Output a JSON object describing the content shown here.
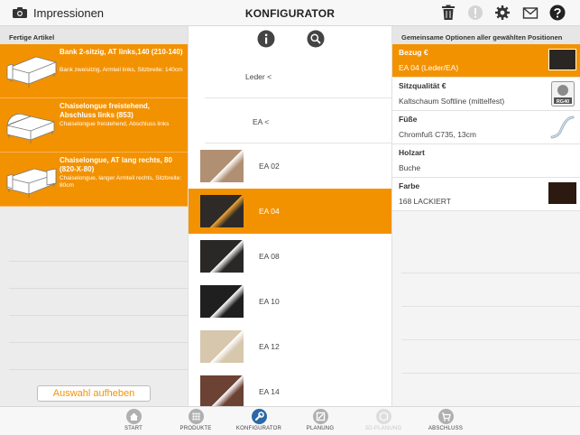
{
  "header": {
    "left_label": "Impressionen",
    "title": "KONFIGURATOR"
  },
  "left": {
    "heading": "Fertige Artikel",
    "articles": [
      {
        "title": "Bank 2-sitzig, AT links,140 (210-140)",
        "subtitle": "Bank zweisitzig, Armteil links, Sitzbreite: 140cm"
      },
      {
        "title": "Chaiselongue freistehend, Abschluss links (853)",
        "subtitle": "Chaiselongue freistehend, Abschluss links"
      },
      {
        "title": "Chaiselongue, AT lang rechts, 80 (820-X-80)",
        "subtitle": "Chaiselongue, langer Armteil rechts, Sitzbreite: 80cm"
      }
    ],
    "selection_button": "Auswahl aufheben"
  },
  "middle": {
    "filters": [
      "Leder <",
      "EA <"
    ],
    "swatches": [
      {
        "label": "EA 02",
        "color": "#b08f72",
        "active": false
      },
      {
        "label": "EA 04",
        "color": "#2e2a27",
        "active": true
      },
      {
        "label": "EA 08",
        "color": "#2a2826",
        "active": false
      },
      {
        "label": "EA 10",
        "color": "#1f1f1f",
        "active": false
      },
      {
        "label": "EA 12",
        "color": "#d6c7ad",
        "active": false
      },
      {
        "label": "EA 14",
        "color": "#6b4234",
        "active": false
      }
    ]
  },
  "right": {
    "heading": "Gemeinsame Optionen aller gewählten Positionen",
    "options": [
      {
        "title": "Bezug €",
        "value": "EA 04 (Leder/EA)",
        "active": true
      },
      {
        "title": "Sitzqualität €",
        "value": "Kaltschaum Softline (mittelfest)",
        "badge": "RG40",
        "active": false
      },
      {
        "title": "Füße",
        "value": "Chromfuß C735, 13cm",
        "active": false
      },
      {
        "title": "Holzart",
        "value": "Buche",
        "active": false
      },
      {
        "title": "Farbe",
        "value": "168 LACKIERT",
        "active": false
      }
    ]
  },
  "tabs": [
    {
      "label": "START",
      "icon": "home-icon",
      "state": "normal"
    },
    {
      "label": "PRODUKTE",
      "icon": "grid-icon",
      "state": "normal"
    },
    {
      "label": "KONFIGURATOR",
      "icon": "wrench-icon",
      "state": "active"
    },
    {
      "label": "PLANUNG",
      "icon": "planning-icon",
      "state": "normal"
    },
    {
      "label": "3D-PLANUNG",
      "icon": "cube-icon",
      "state": "disabled"
    },
    {
      "label": "ABSCHLUSS",
      "icon": "cart-icon",
      "state": "normal"
    }
  ],
  "colors": {
    "accent": "#f39200",
    "tab_active": "#2b68a8"
  }
}
